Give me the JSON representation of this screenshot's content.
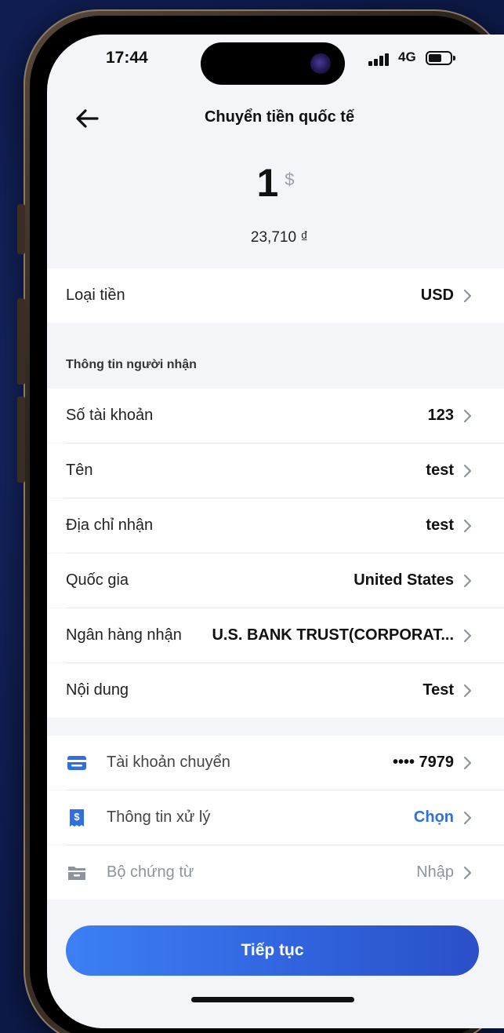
{
  "status_bar": {
    "time": "17:44",
    "network": "4G"
  },
  "header": {
    "title": "Chuyển tiền quốc tế",
    "back_icon": "arrow-left-icon"
  },
  "amount": {
    "value": "1",
    "currency_symbol": "$",
    "converted": "23,710 ₫"
  },
  "currency_row": {
    "label": "Loại tiền",
    "value": "USD"
  },
  "recipient_section": {
    "title": "Thông tin người nhận",
    "rows": [
      {
        "label": "Số tài khoản",
        "value": "123"
      },
      {
        "label": "Tên",
        "value": "test"
      },
      {
        "label": "Địa chỉ nhận",
        "value": "test"
      },
      {
        "label": "Quốc gia",
        "value": "United States"
      },
      {
        "label": "Ngân hàng nhận",
        "value": "U.S. BANK TRUST(CORPORAT..."
      },
      {
        "label": "Nội dung",
        "value": "Test"
      }
    ]
  },
  "transfer_section": {
    "rows": [
      {
        "label": "Tài khoản chuyển",
        "value": "•••• 7979",
        "icon": "card-icon"
      },
      {
        "label": "Thông tin xử lý",
        "value": "Chọn",
        "icon": "receipt-dollar-icon"
      },
      {
        "label": "Bộ chứng từ",
        "value": "Nhập",
        "icon": "folder-icon"
      }
    ]
  },
  "cta": {
    "label": "Tiếp tục"
  },
  "colors": {
    "accent": "#2f6fe0",
    "background": "#f4f5f9",
    "cta_start": "#3d7ff5",
    "cta_end": "#2b4fc8"
  }
}
